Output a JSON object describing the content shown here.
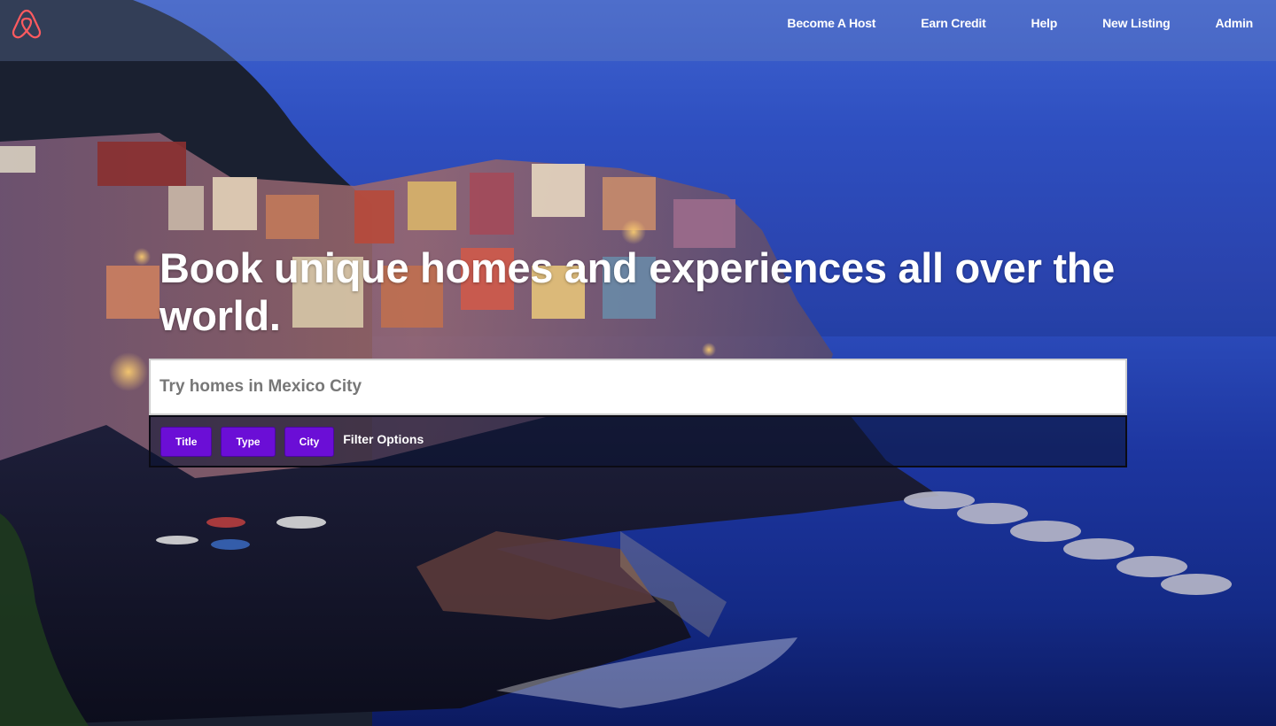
{
  "nav": {
    "logo": "airbnb-logo",
    "links": [
      "Become A Host",
      "Earn Credit",
      "Help",
      "New Listing",
      "Admin"
    ]
  },
  "hero": {
    "headline": "Book unique homes and experiences all over the world.",
    "search_placeholder": "Try homes in Mexico City"
  },
  "filters": {
    "buttons": [
      "Title",
      "Type",
      "City"
    ],
    "label": "Filter Options"
  },
  "colors": {
    "brand": "#ff5a5f",
    "filter_button": "#6b0ed6"
  }
}
